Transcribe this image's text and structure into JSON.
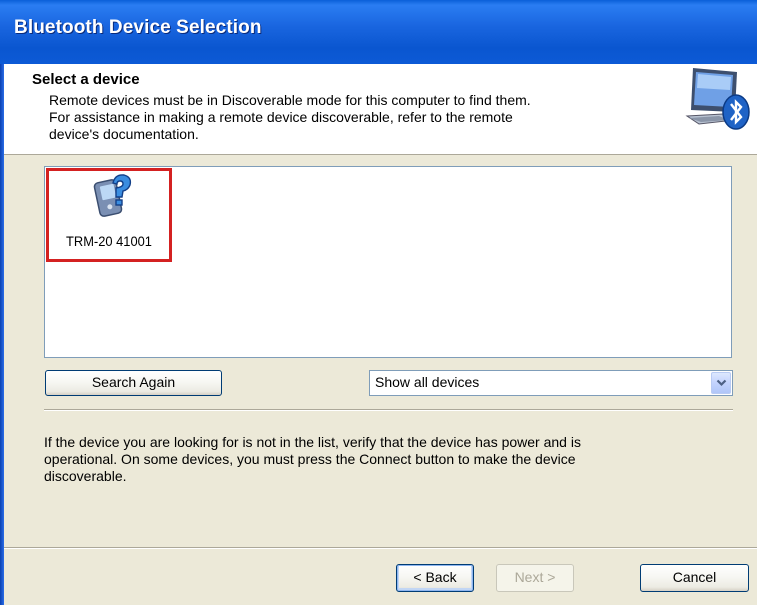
{
  "window": {
    "title": "Bluetooth Device Selection"
  },
  "header": {
    "title": "Select a device",
    "description_lines": [
      "Remote devices must be in Discoverable mode for this computer to find them.",
      "For assistance in making a remote device discoverable, refer to the remote",
      "device's documentation."
    ],
    "icon": "computer-bluetooth-icon"
  },
  "device_list": {
    "items": [
      {
        "label": "TRM-20  41001",
        "icon": "unknown-handheld-device-icon",
        "highlighted": true
      }
    ]
  },
  "controls": {
    "search_again_label": "Search Again",
    "filter_value": "Show all devices"
  },
  "info": {
    "lines": [
      "If the device you are looking for is not in the list, verify that the device has power and is",
      "operational. On some devices, you must press the Connect button to make the device",
      "discoverable."
    ]
  },
  "footer": {
    "back_label": "< Back",
    "next_label": "Next >",
    "cancel_label": "Cancel"
  },
  "colors": {
    "titlebar": "#0a56d0",
    "highlight_border": "#d42121",
    "dialog_background": "#ece9d8"
  }
}
